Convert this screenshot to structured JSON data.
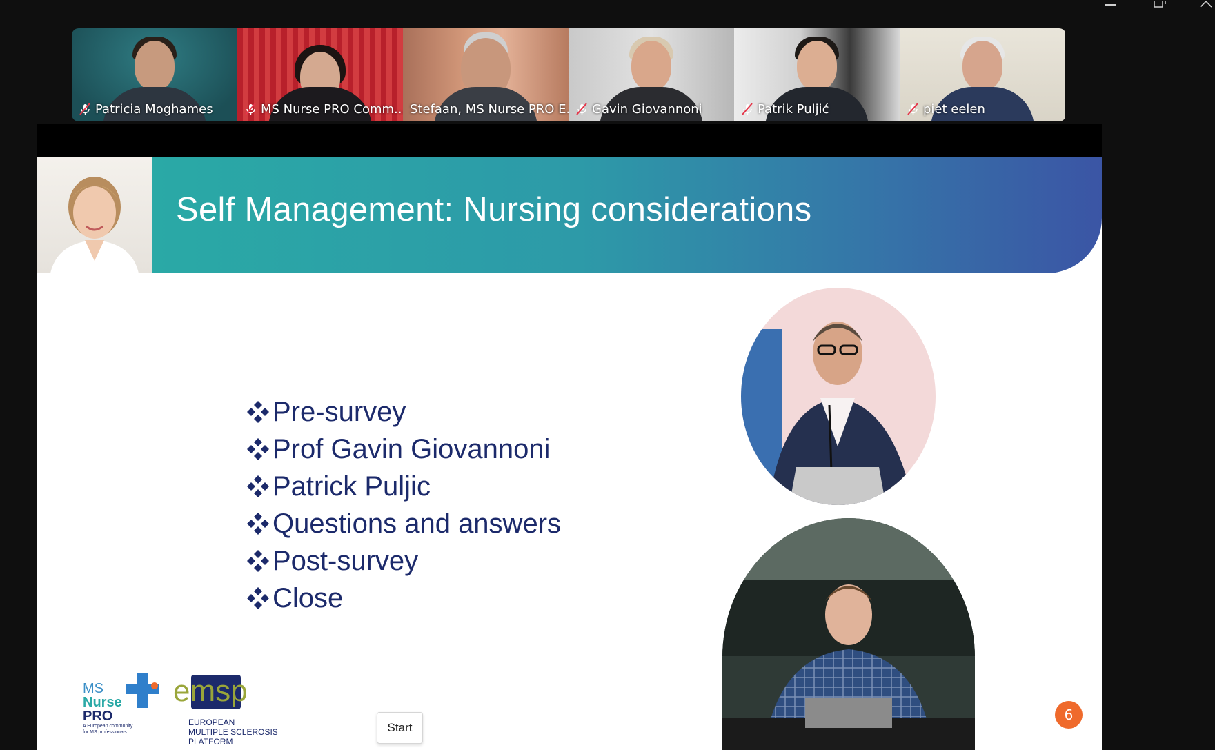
{
  "window": {
    "controls": [
      "minimize-icon",
      "restore-icon",
      "close-icon"
    ]
  },
  "participants": [
    {
      "name": "Patricia Moghames",
      "muted": true,
      "active": false
    },
    {
      "name": "MS Nurse PRO Comm...",
      "muted": true,
      "active": false
    },
    {
      "name": "Stefaan, MS Nurse PRO E...",
      "muted": false,
      "active": true
    },
    {
      "name": "Gavin Giovannoni",
      "muted": true,
      "active": false
    },
    {
      "name": "Patrik Puljić",
      "muted": true,
      "active": false
    },
    {
      "name": "piet eelen",
      "muted": true,
      "active": false
    }
  ],
  "slide": {
    "title": "Self Management: Nursing considerations",
    "bullets": [
      "Pre-survey",
      "Prof Gavin Giovannoni",
      "Patrick Puljic",
      "Questions and answers",
      "Post-survey",
      "Close"
    ],
    "page_number": "6",
    "start_label": "Start",
    "logo_ms": {
      "line1": "MS",
      "line2": "Nurse",
      "line3": "PRO",
      "tagline1": "A European community",
      "tagline2": "for MS professionals"
    },
    "logo_emsp": {
      "word": "emsp",
      "line1": "EUROPEAN",
      "line2": "MULTIPLE SCLEROSIS",
      "line3": "PLATFORM"
    }
  },
  "colors": {
    "active_border": "#2dd46e",
    "bullet_text": "#1c2a6b",
    "banner_start": "#2aa9a6",
    "banner_end": "#3b55a5",
    "page_badge": "#ef6a2c"
  }
}
